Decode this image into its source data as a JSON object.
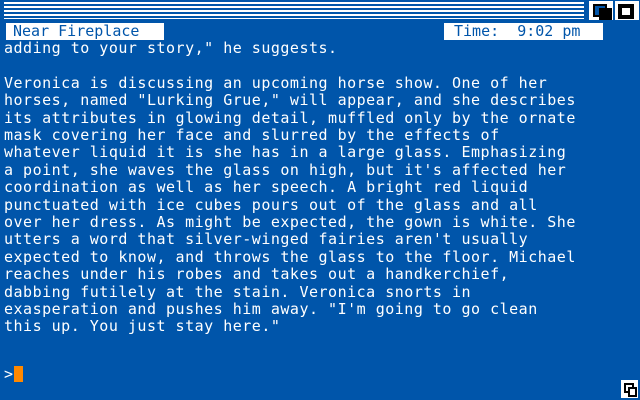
{
  "window": {
    "location": "Near Fireplace",
    "time_label": "Time:",
    "time_value": "9:02 pm"
  },
  "story": {
    "first_line": "adding to your story,\" he suggests.",
    "paragraph_lines": [
      "Veronica is discussing an upcoming horse show. One of her",
      "horses, named \"Lurking Grue,\" will appear, and she describes",
      "its attributes in glowing detail, muffled only by the ornate",
      "mask covering her face and slurred by the effects of",
      "whatever liquid it is she has in a large glass. Emphasizing",
      "a point, she waves the glass on high, but it's affected her",
      "coordination as well as her speech. A bright red liquid",
      "punctuated with ice cubes pours out of the glass and all",
      "over her dress. As might be expected, the gown is white. She",
      "utters a word that silver-winged fairies aren't usually",
      "expected to know, and throws the glass to the floor. Michael",
      "reaches under his robes and takes out a handkerchief,",
      "dabbing futilely at the stain. Veronica snorts in",
      "exasperation and pushes him away. \"I'm going to go clean",
      "this up. You just stay here.\""
    ]
  },
  "prompt": {
    "symbol": ">",
    "input": ""
  },
  "colors": {
    "background": "#0055aa",
    "text": "#ffffff",
    "cursor": "#ff8800"
  },
  "icons": {
    "depth": "depth-arrange-icon",
    "zoom": "zoom-icon",
    "resize": "resize-icon"
  }
}
